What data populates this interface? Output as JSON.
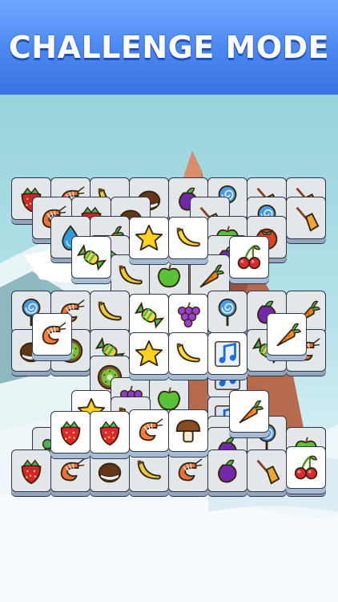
{
  "banner": {
    "title": "CHALLENGE MODE"
  },
  "board": {
    "back_tiles": [
      {
        "icon": "strawberry-icon"
      },
      {
        "icon": "shrimp-icon"
      },
      {
        "icon": "banana-icon"
      },
      {
        "icon": "coconut-icon"
      },
      {
        "icon": "eggplant-icon"
      },
      {
        "icon": "lollipop-icon"
      },
      {
        "icon": "broom-icon"
      },
      {
        "icon": "broom-icon"
      },
      {
        "icon": "shrimp-icon"
      },
      {
        "icon": "strawberry-icon"
      },
      {
        "icon": "coconut-icon"
      },
      {
        "icon": "broom-icon"
      },
      {
        "icon": "lollipop-icon"
      },
      {
        "icon": "broom-icon"
      },
      {
        "icon": "water-drop-icon"
      },
      {
        "icon": "carrot-icon"
      },
      {
        "icon": "apple-icon"
      },
      {
        "icon": "tomato-icon"
      },
      {
        "icon": "candy-icon"
      },
      {
        "icon": "music-note-icon"
      },
      {
        "icon": "eggplant-icon"
      },
      {
        "icon": "banana-icon"
      },
      {
        "icon": "apple-icon"
      },
      {
        "icon": "carrot-icon"
      },
      {
        "icon": "lollipop-icon"
      },
      {
        "icon": "shrimp-icon"
      },
      {
        "icon": "banana-icon"
      },
      {
        "icon": "lollipop-icon"
      },
      {
        "icon": "eggplant-icon"
      },
      {
        "icon": "carrot-icon"
      },
      {
        "icon": "coconut-icon"
      },
      {
        "icon": "kiwi-icon"
      },
      {
        "icon": "candy-icon"
      },
      {
        "icon": "candy-icon"
      },
      {
        "icon": "shrimp-icon"
      },
      {
        "icon": "kiwi-icon"
      },
      {
        "icon": "music-note-icon"
      },
      {
        "icon": "grapes-icon"
      },
      {
        "icon": "apple-icon"
      },
      {
        "icon": "banana-icon"
      },
      {
        "icon": "music-note-icon"
      },
      {
        "icon": "candy-icon"
      },
      {
        "icon": "eggplant-icon"
      },
      {
        "icon": "lollipop-icon"
      },
      {
        "icon": "clover-icon"
      },
      {
        "icon": "broom-icon"
      },
      {
        "icon": "eggplant-icon"
      },
      {
        "icon": "apple-icon"
      },
      {
        "icon": "strawberry-icon"
      },
      {
        "icon": "shrimp-icon"
      },
      {
        "icon": "coconut-icon"
      },
      {
        "icon": "banana-icon"
      },
      {
        "icon": "shrimp-icon"
      },
      {
        "icon": "eggplant-icon"
      },
      {
        "icon": "broom-icon"
      },
      {
        "icon": "cherries-icon"
      }
    ],
    "top_tiles": [
      {
        "icon": "star-icon"
      },
      {
        "icon": "banana-icon"
      },
      {
        "icon": "candy-icon"
      },
      {
        "icon": "cherries-icon"
      },
      {
        "icon": "candy-icon"
      },
      {
        "icon": "grapes-icon"
      },
      {
        "icon": "shrimp-icon"
      },
      {
        "icon": "carrot-icon"
      },
      {
        "icon": "star-icon"
      },
      {
        "icon": "banana-icon"
      },
      {
        "icon": "music-note-icon"
      },
      {
        "icon": "star-icon"
      },
      {
        "icon": "carrot-icon"
      },
      {
        "icon": "shrimp-icon"
      },
      {
        "icon": "mushroom-icon"
      },
      {
        "icon": "strawberry-icon"
      },
      {
        "icon": "strawberry-icon"
      },
      {
        "icon": "cherries-icon"
      }
    ]
  }
}
